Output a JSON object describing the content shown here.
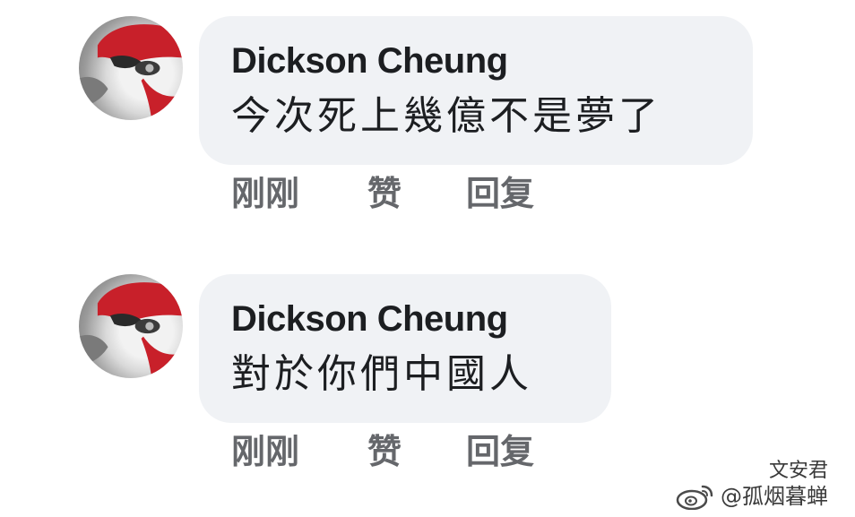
{
  "comments": [
    {
      "author": "Dickson Cheung",
      "text": "今次死上幾億不是夢了",
      "time": "刚刚",
      "like_label": "赞",
      "reply_label": "回复"
    },
    {
      "author": "Dickson Cheung",
      "text": "對於你們中國人",
      "time": "刚刚",
      "like_label": "赞",
      "reply_label": "回复"
    }
  ],
  "watermark": {
    "line1": "文安君",
    "line2": "@孤烟暮蝉",
    "icon": "weibo-icon"
  },
  "colors": {
    "bubble_bg": "#f0f2f5",
    "author_text": "#1c1e21",
    "action_text": "#65676b",
    "avatar_red": "#c8202a"
  }
}
